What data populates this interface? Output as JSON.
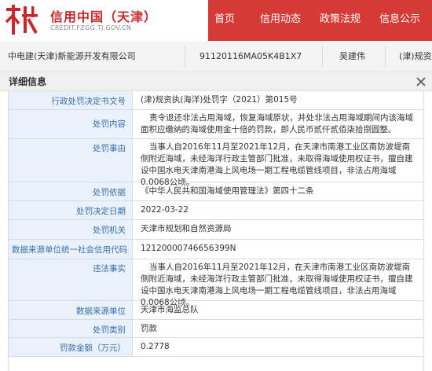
{
  "header": {
    "logo_char": "信",
    "title": "信用中国（天津）",
    "subtitle": "CREDIT.FZGG.TJ.GOV.CN",
    "nav": [
      "首页",
      "信用动态",
      "政策法规",
      "信息公示"
    ]
  },
  "company_row": {
    "name": "中电建(天津)新能源开发有限公司",
    "credit_code": "91120116MA05K4B1X7",
    "person": "吴建伟",
    "doc_no_partial": "(津)规资"
  },
  "modal": {
    "title": "详细信息",
    "rows": [
      {
        "label": "行政处罚决定书文号",
        "value": "(津)规资执(海洋)处罚字（2021）第015号"
      },
      {
        "label": "处罚内容",
        "value": "责令退还非法占用海域，恢复海域原状，并处非法占用海域期间内该海域面积应缴纳的海域使用金十倍的罚款，即人民币贰仟贰佰柒拾捌圆整。"
      },
      {
        "label": "处罚事由",
        "value": "当事人自2016年11月至2021年12月，在天津市南港工业区南防波堤南侧附近海域，未经海洋行政主管部门批准，未取得海域使用权证书，擅自建设中国水电天津南港海上风电场一期工程电缆管线项目，非法占用海域0.0068公顷。"
      },
      {
        "label": "处罚依据",
        "value": "《中华人民共和国海域使用管理法》第四十二条"
      },
      {
        "label": "处罚决定日期",
        "value": "2022-03-22"
      },
      {
        "label": "处罚机关",
        "value": "天津市规划和自然资源局"
      },
      {
        "label": "数据来源单位统一社会信用代码",
        "value": "12120000746656399N"
      },
      {
        "label": "违法事实",
        "value": "当事人自2016年11月至2021年12月，在天津市南港工业区南防波堤南侧附近海域，未经海洋行政主管部门批准，未取得海域使用权证书，擅自建设中国水电天津南港海上风电场一期工程电缆管线项目，非法占用海域0.0068公顷。"
      },
      {
        "label": "数据来源单位",
        "value": "天津市海监总队"
      },
      {
        "label": "处罚类别",
        "value": "罚款"
      },
      {
        "label": "罚款金额（万元）",
        "value": "0.2778"
      }
    ]
  }
}
